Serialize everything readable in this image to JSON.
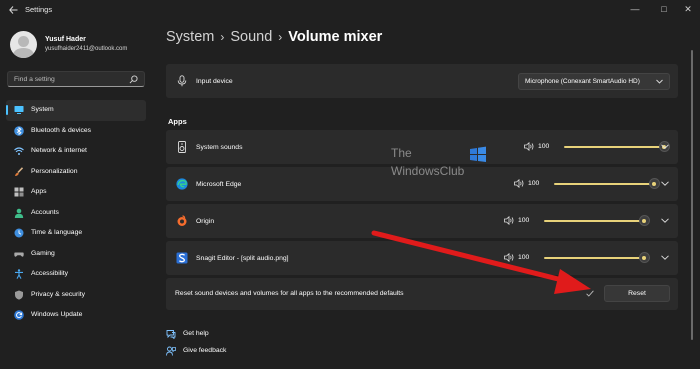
{
  "window": {
    "title": "Settings",
    "minimize_glyph": "—",
    "maximize_glyph": "□",
    "close_glyph": "✕"
  },
  "user": {
    "name": "Yusuf Hader",
    "email": "yusufhaider2411@outlook.com"
  },
  "search": {
    "placeholder": "Find a setting",
    "icon": "search-icon"
  },
  "sidebar": {
    "accent_color": "#4cc2ff",
    "items": [
      {
        "label": "System",
        "icon": "display-icon",
        "active": true
      },
      {
        "label": "Bluetooth & devices",
        "icon": "bluetooth-icon"
      },
      {
        "label": "Network & internet",
        "icon": "wifi-icon"
      },
      {
        "label": "Personalization",
        "icon": "brush-icon"
      },
      {
        "label": "Apps",
        "icon": "apps-icon"
      },
      {
        "label": "Accounts",
        "icon": "person-icon"
      },
      {
        "label": "Time & language",
        "icon": "globe-clock-icon"
      },
      {
        "label": "Gaming",
        "icon": "gamepad-icon"
      },
      {
        "label": "Accessibility",
        "icon": "accessibility-icon"
      },
      {
        "label": "Privacy & security",
        "icon": "shield-icon"
      },
      {
        "label": "Windows Update",
        "icon": "update-icon"
      }
    ]
  },
  "breadcrumb": {
    "items": [
      "System",
      "Sound",
      "Volume mixer"
    ],
    "separator": "›"
  },
  "input_device": {
    "label": "Input device",
    "selected": "Microphone (Conexant SmartAudio HD)"
  },
  "apps_section": {
    "title": "Apps",
    "slider_color": "#e8d27a",
    "rows": [
      {
        "name": "System sounds",
        "icon": "speaker-device-icon",
        "volume": 100
      },
      {
        "name": "Microsoft Edge",
        "icon": "edge-icon",
        "volume": 100
      },
      {
        "name": "Origin",
        "icon": "origin-icon",
        "volume": 100
      },
      {
        "name": "Snagit Editor - [split audio.png]",
        "icon": "snagit-icon",
        "volume": 100
      }
    ]
  },
  "reset": {
    "text": "Reset sound devices and volumes for all apps to the recommended defaults",
    "button_label": "Reset"
  },
  "footer": {
    "get_help": "Get help",
    "give_feedback": "Give feedback"
  },
  "watermark": {
    "line1": "The",
    "line2": "WindowsClub"
  },
  "annotation": {
    "arrow_color": "#e01b1b"
  }
}
